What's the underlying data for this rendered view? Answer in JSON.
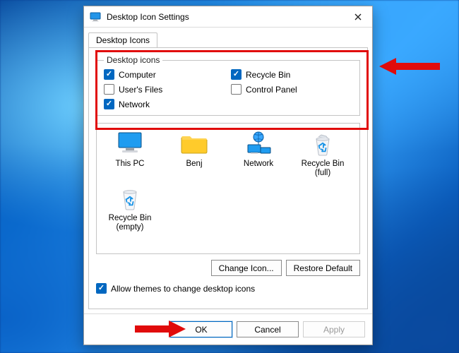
{
  "window": {
    "title": "Desktop Icon Settings",
    "tab_label": "Desktop Icons"
  },
  "group": {
    "legend": "Desktop icons",
    "items": [
      {
        "label": "Computer",
        "checked": true
      },
      {
        "label": "User's Files",
        "checked": false
      },
      {
        "label": "Network",
        "checked": true
      },
      {
        "label": "Recycle Bin",
        "checked": true
      },
      {
        "label": "Control Panel",
        "checked": false
      }
    ]
  },
  "preview_icons": [
    {
      "name": "this-pc",
      "label": "This PC"
    },
    {
      "name": "user-folder",
      "label": "Benj"
    },
    {
      "name": "network",
      "label": "Network"
    },
    {
      "name": "recycle-bin-full",
      "label": "Recycle Bin (full)"
    },
    {
      "name": "recycle-bin-empty",
      "label": "Recycle Bin (empty)"
    }
  ],
  "buttons": {
    "change_icon": "Change Icon...",
    "restore_default": "Restore Default",
    "ok": "OK",
    "cancel": "Cancel",
    "apply": "Apply"
  },
  "allow_themes": {
    "label": "Allow themes to change desktop icons",
    "checked": true
  },
  "colors": {
    "accent": "#0067c0",
    "annotation": "#e10b0b"
  }
}
